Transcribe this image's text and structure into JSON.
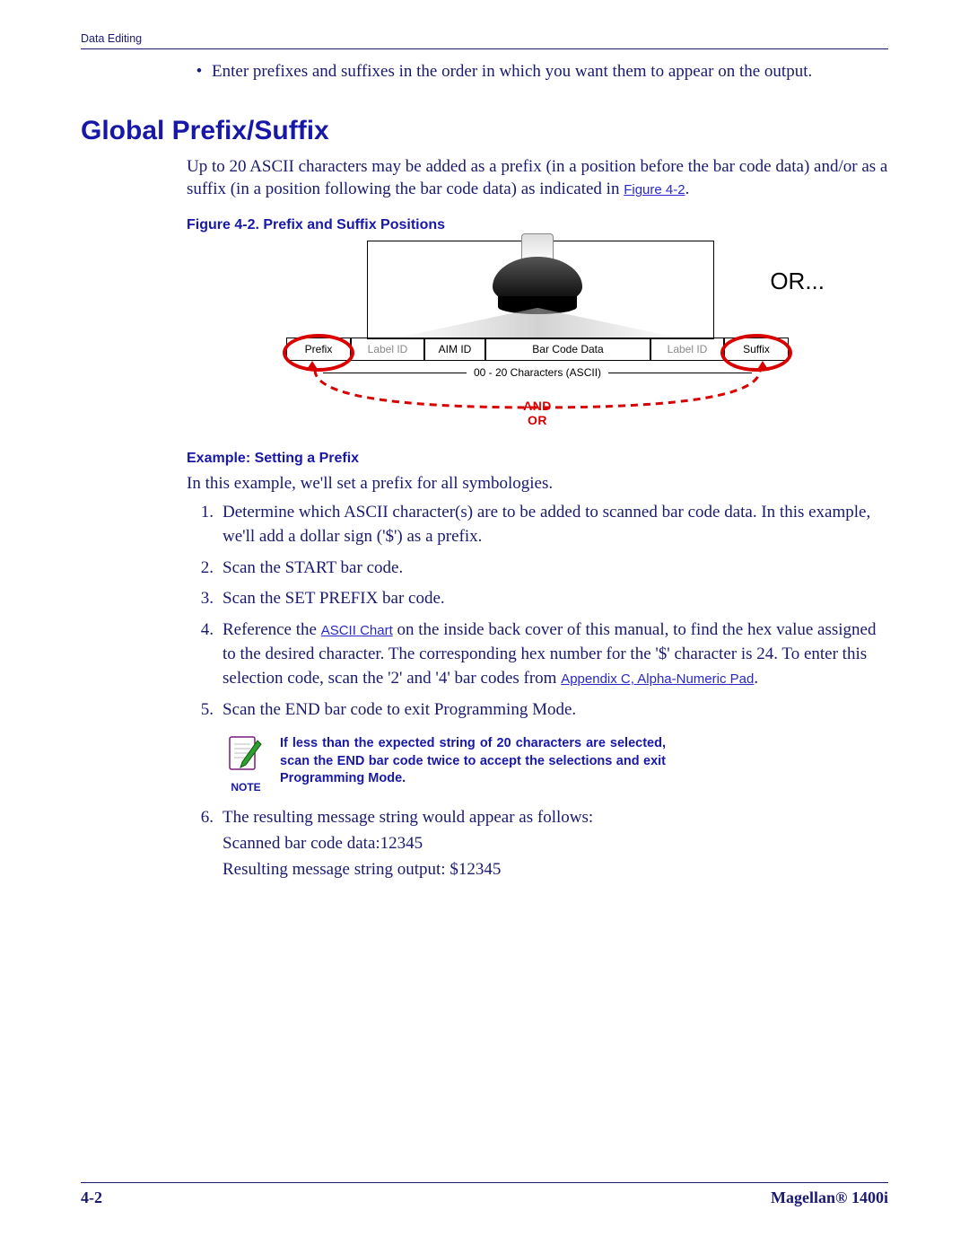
{
  "header": {
    "running": "Data Editing"
  },
  "bullet": "Enter prefixes and suffixes in the order in which you want them to appear on the output.",
  "heading": "Global Prefix/Suffix",
  "intro": {
    "pre": "Up to 20 ASCII characters may be added as a prefix (in a position before the bar code data) and/or as a suffix (in a position following the bar code data) as indicated in ",
    "link": "Figure 4-2",
    "post": "."
  },
  "figure": {
    "caption": "Figure 4-2. Prefix and Suffix Positions",
    "or": "OR...",
    "cells": [
      "Prefix",
      "Label ID",
      "AIM ID",
      "Bar Code Data",
      "Label ID",
      "Suffix"
    ],
    "sub": "00 - 20 Characters (ASCII)",
    "and": "AND",
    "or2": "OR"
  },
  "example": {
    "heading": "Example: Setting a Prefix",
    "intro": "In this example, we'll set a prefix for all symbologies.",
    "steps": {
      "s1": "Determine which ASCII character(s) are to be added to scanned bar code data. In this example, we'll add a dollar sign ('$') as a prefix.",
      "s2": "Scan the START bar code.",
      "s3": "Scan the SET PREFIX bar code.",
      "s4a": "Reference the ",
      "s4link1": "ASCII Chart",
      "s4b": " on the inside back cover of this manual, to find the hex value assigned to the desired character. The corresponding hex number for the '$' character is 24. To enter this selection code, scan the '2' and '4' bar codes from ",
      "s4link2": "Appendix C, Alpha-Numeric Pad",
      "s4c": ".",
      "s5": "Scan the END bar code to exit Programming Mode.",
      "s6": "The resulting message string would appear as follows:",
      "s6a": "Scanned bar code data:12345",
      "s6b": "Resulting message string output: $12345"
    }
  },
  "note": {
    "label": "NOTE",
    "text": "If less than the expected string of 20 characters are selected, scan the END bar code twice to accept the selections and exit Programming Mode."
  },
  "footer": {
    "left": "4-2",
    "right": "Magellan® 1400i"
  }
}
